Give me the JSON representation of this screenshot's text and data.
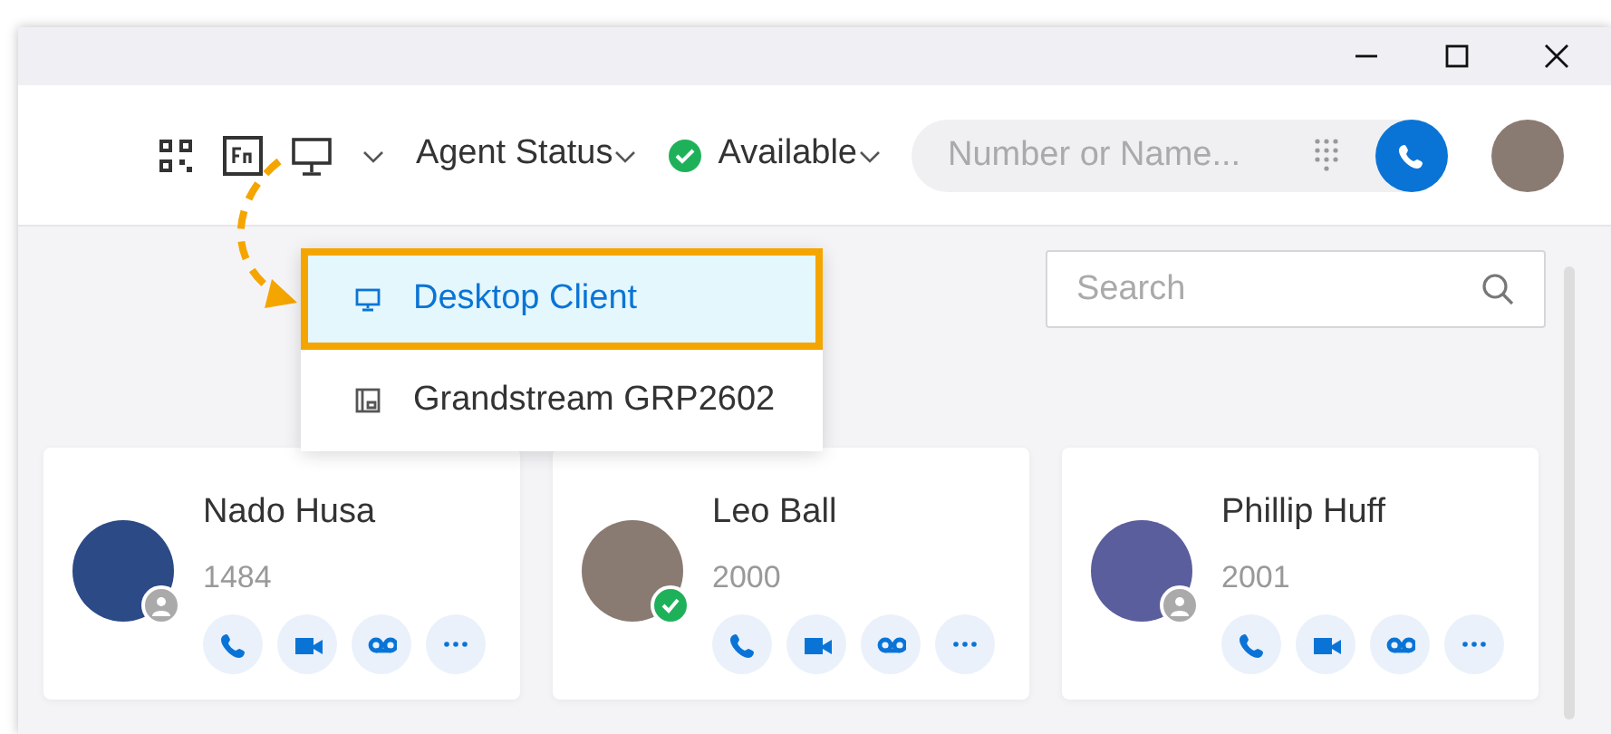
{
  "toolbar": {
    "agent_status": "Agent Status",
    "presence": {
      "label": "Available",
      "available": true
    },
    "dial": {
      "placeholder": "Number or Name..."
    }
  },
  "device_menu": {
    "items": [
      {
        "label": "Desktop Client",
        "kind": "desktop",
        "selected": true
      },
      {
        "label": "Grandstream GRP2602",
        "kind": "phone",
        "selected": false
      }
    ]
  },
  "search": {
    "placeholder": "Search"
  },
  "contacts": [
    {
      "name": "Nado Husa",
      "extension": "1484",
      "available": false
    },
    {
      "name": "Leo Ball",
      "extension": "2000",
      "available": true
    },
    {
      "name": "Phillip Huff",
      "extension": "2001",
      "available": false
    }
  ]
}
